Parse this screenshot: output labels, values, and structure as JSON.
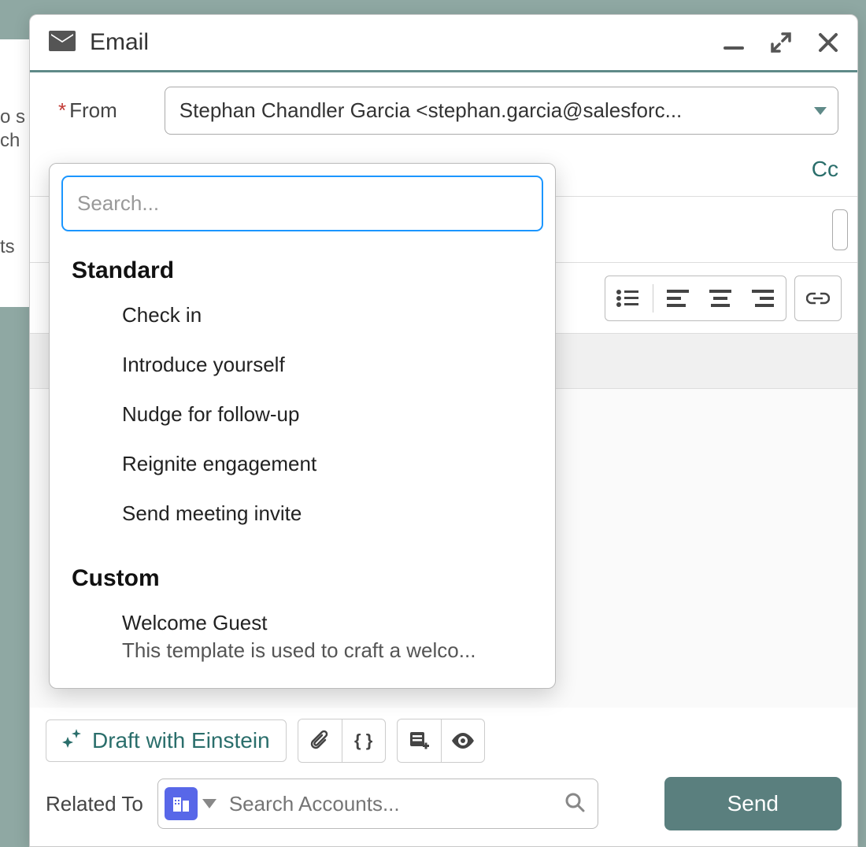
{
  "bg": {
    "line1": "o s",
    "line2": "ch",
    "line3": "ts"
  },
  "header": {
    "title": "Email"
  },
  "from": {
    "label": "From",
    "value": "Stephan Chandler Garcia <stephan.garcia@salesforc..."
  },
  "cc": "Cc",
  "footer": {
    "draft_label": "Draft with Einstein",
    "braces": "{ }",
    "related_label": "Related To",
    "related_placeholder": "Search Accounts...",
    "send": "Send"
  },
  "dropdown": {
    "search_placeholder": "Search...",
    "sections": {
      "standard": {
        "title": "Standard",
        "items": [
          {
            "label": "Check in"
          },
          {
            "label": "Introduce yourself"
          },
          {
            "label": "Nudge for follow-up"
          },
          {
            "label": "Reignite engagement"
          },
          {
            "label": "Send meeting invite"
          }
        ]
      },
      "custom": {
        "title": "Custom",
        "items": [
          {
            "label": "Welcome Guest",
            "desc": "This template is used to craft a welco..."
          }
        ]
      }
    }
  }
}
